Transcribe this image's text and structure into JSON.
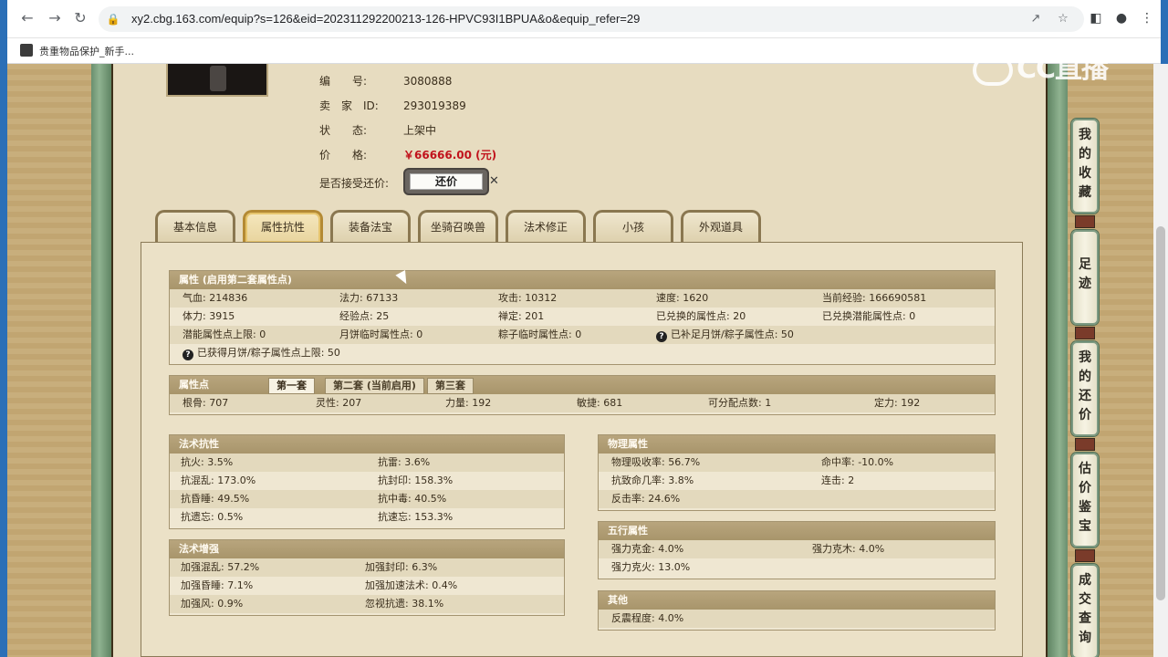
{
  "browser": {
    "url": "xy2.cbg.163.com/equip?s=126&eid=202311292200213-126-HPVC93I1BPUA&o&equip_refer=29",
    "bookmark": "贵重物品保护_新手..."
  },
  "watermark": "CC直播",
  "item_info": {
    "serial_key": "编　　号:",
    "serial_value": "3080888",
    "seller_key": "卖　家　ID:",
    "seller_value": "293019389",
    "status_key": "状　　态:",
    "status_value": "上架中",
    "price_key": "价　　格:",
    "price_value": "￥66666.00 (元)",
    "haggle_key": "是否接受还价:",
    "haggle_button": "还价",
    "haggle_close": "✕"
  },
  "tabs": [
    "基本信息",
    "属性抗性",
    "装备法宝",
    "坐骑召唤兽",
    "法术修正",
    "小孩",
    "外观道具"
  ],
  "attributes": {
    "title": "属性 (启用第二套属性点)",
    "rows": [
      [
        "气血: 214836",
        "法力: 67133",
        "攻击: 10312",
        "速度: 1620",
        "当前经验: 166690581"
      ],
      [
        "体力: 3915",
        "经验点: 25",
        "禅定: 201",
        "已兑换的属性点: 20",
        "已兑换潜能属性点: 0"
      ],
      [
        "潜能属性点上限: 0",
        "月饼临时属性点: 0",
        "粽子临时属性点: 0",
        "已补足月饼/粽子属性点: 50",
        ""
      ]
    ],
    "footer": "已获得月饼/粽子属性点上限: 50"
  },
  "points": {
    "title": "属性点",
    "subtabs": [
      "第一套",
      "第二套 (当前启用)",
      "第三套"
    ],
    "values": [
      "根骨: 707",
      "灵性: 207",
      "力量: 192",
      "敏捷: 681",
      "可分配点数: 1",
      "定力: 192"
    ]
  },
  "resist": {
    "title": "法术抗性",
    "rows": [
      [
        "抗火: 3.5%",
        "抗雷: 3.6%"
      ],
      [
        "抗混乱: 173.0%",
        "抗封印: 158.3%"
      ],
      [
        "抗昏睡: 49.5%",
        "抗中毒: 40.5%"
      ],
      [
        "抗遗忘: 0.5%",
        "抗速忘: 153.3%"
      ]
    ]
  },
  "enhance": {
    "title": "法术增强",
    "rows": [
      [
        "加强混乱: 57.2%",
        "加强封印: 6.3%"
      ],
      [
        "加强昏睡: 7.1%",
        "加强加速法术: 0.4%"
      ],
      [
        "加强风: 0.9%",
        "忽视抗遗: 38.1%"
      ]
    ]
  },
  "physical": {
    "title": "物理属性",
    "rows": [
      [
        "物理吸收率: 56.7%",
        "命中率: -10.0%"
      ],
      [
        "抗致命几率: 3.8%",
        "连击: 2"
      ],
      [
        "反击率: 24.6%",
        ""
      ]
    ]
  },
  "elements": {
    "title": "五行属性",
    "rows": [
      [
        "强力克金: 4.0%",
        "强力克木: 4.0%"
      ],
      [
        "强力克火: 13.0%",
        ""
      ]
    ]
  },
  "other": {
    "title": "其他",
    "rows": [
      [
        "反震程度: 4.0%"
      ]
    ]
  },
  "right_nav": [
    "我的收藏",
    "足迹",
    "我的还价",
    "估价鉴宝",
    "成交查询"
  ]
}
